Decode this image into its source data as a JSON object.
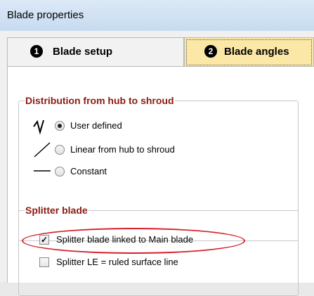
{
  "window": {
    "title": "Blade properties"
  },
  "tabs": [
    {
      "number": "1",
      "label": "Blade setup",
      "selected": false
    },
    {
      "number": "2",
      "label": "Blade angles",
      "selected": true
    }
  ],
  "distribution": {
    "legend": "Distribution from hub to shroud",
    "options": [
      {
        "label": "User defined",
        "checked": true,
        "icon": "user-curve-icon"
      },
      {
        "label": "Linear from hub to shroud",
        "checked": false,
        "icon": "linear-line-icon"
      },
      {
        "label": "Constant",
        "checked": false,
        "icon": "constant-line-icon"
      }
    ]
  },
  "splitter": {
    "legend": "Splitter blade",
    "linked_label": "Splitter blade linked to Main blade",
    "linked_checked": true,
    "ruled_label": "Splitter LE = ruled surface line",
    "ruled_checked": false,
    "check_glyph": "✓"
  },
  "colors": {
    "group_legend": "#8b1a12",
    "highlight": "#d5202a",
    "active_tab": "#fbe7a6"
  }
}
